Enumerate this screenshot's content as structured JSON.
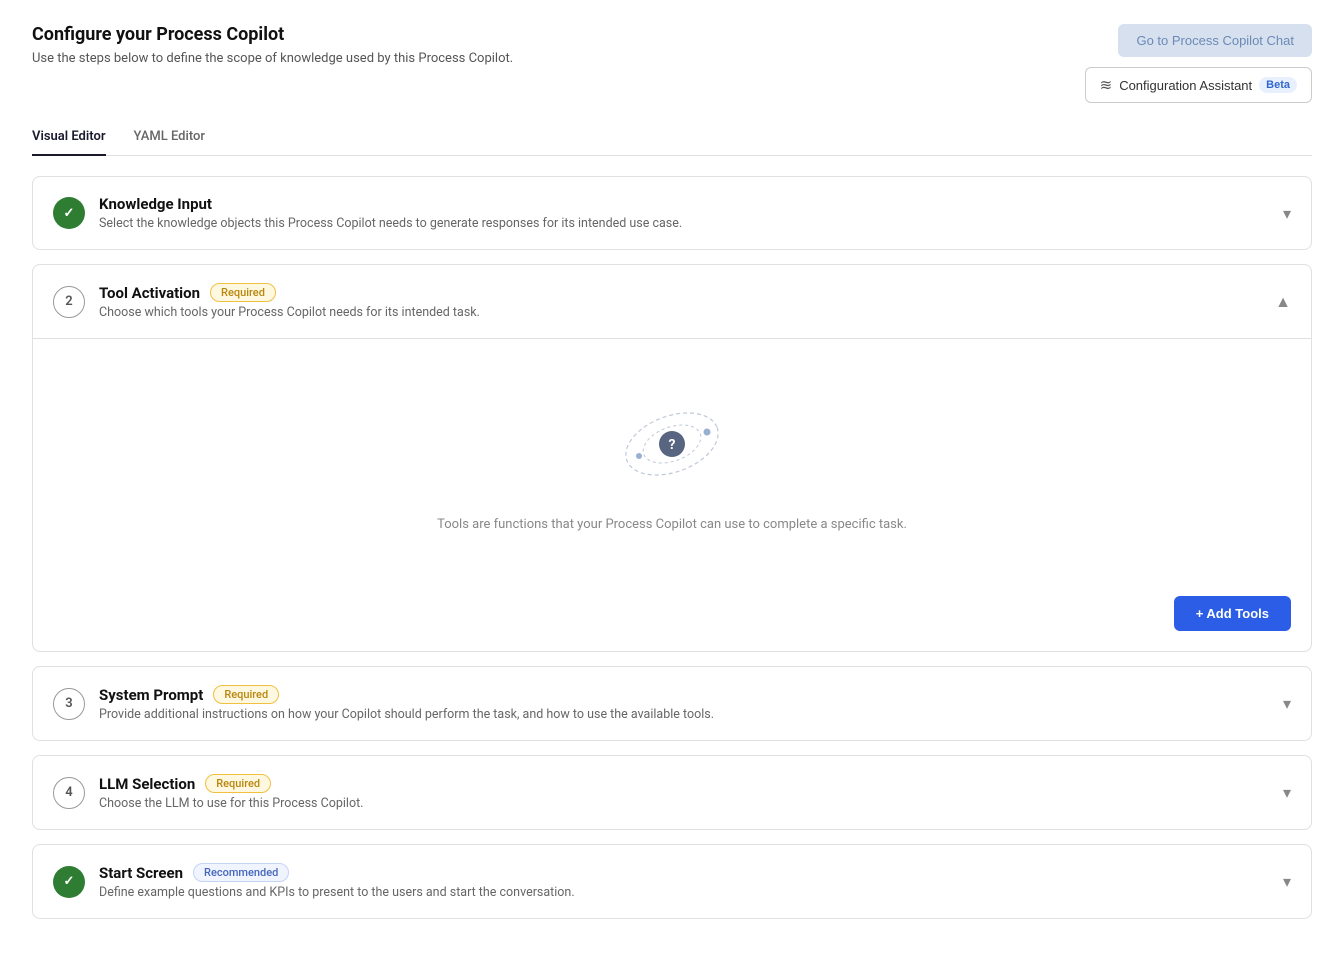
{
  "header": {
    "title": "Configure your Process Copilot",
    "subtitle": "Use the steps below to define the scope of knowledge used by this Process Copilot.",
    "goto_chat_btn": "Go to Process Copilot Chat",
    "config_assistant_btn": "Configuration Assistant",
    "config_assistant_beta": "Beta"
  },
  "tabs": [
    {
      "label": "Visual Editor",
      "active": true
    },
    {
      "label": "YAML Editor",
      "active": false
    }
  ],
  "sections": [
    {
      "id": "knowledge-input",
      "step": "check",
      "title": "Knowledge Input",
      "badge": null,
      "desc": "Select the knowledge objects this Process Copilot needs to generate responses for its intended use case.",
      "expanded": false,
      "chevron": "▾"
    },
    {
      "id": "tool-activation",
      "step": "2",
      "title": "Tool Activation",
      "badge": "Required",
      "badge_type": "required",
      "desc": "Choose which tools your Process Copilot needs for its intended task.",
      "expanded": true,
      "chevron": "▲",
      "empty_state_text": "Tools are functions that your Process Copilot can use to complete a specific task.",
      "add_tools_btn": "+ Add Tools"
    },
    {
      "id": "system-prompt",
      "step": "3",
      "title": "System Prompt",
      "badge": "Required",
      "badge_type": "required",
      "desc": "Provide additional instructions on how your Copilot should perform the task, and how to use the available tools.",
      "expanded": false,
      "chevron": "▾"
    },
    {
      "id": "llm-selection",
      "step": "4",
      "title": "LLM Selection",
      "badge": "Required",
      "badge_type": "required",
      "desc": "Choose the LLM to use for this Process Copilot.",
      "expanded": false,
      "chevron": "▾"
    },
    {
      "id": "start-screen",
      "step": "check",
      "title": "Start Screen",
      "badge": "Recommended",
      "badge_type": "recommended",
      "desc": "Define example questions and KPIs to present to the users and start the conversation.",
      "expanded": false,
      "chevron": "▾"
    }
  ]
}
